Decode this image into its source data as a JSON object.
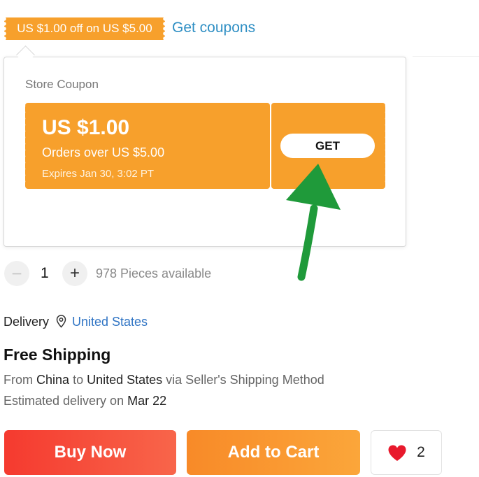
{
  "coupon_strip": {
    "tag_text": "US $1.00 off on US $5.00",
    "get_coupons_link": "Get coupons"
  },
  "popover": {
    "title": "Store Coupon",
    "coupon": {
      "amount": "US $1.00",
      "condition": "Orders over US $5.00",
      "expiry": "Expires Jan 30, 3:02 PT",
      "get_button": "GET"
    }
  },
  "quantity": {
    "minus": "−",
    "value": "1",
    "plus": "+",
    "available": "978 Pieces available"
  },
  "delivery": {
    "label": "Delivery",
    "location_icon": "map-pin-icon",
    "country": "United States"
  },
  "shipping": {
    "title": "Free Shipping",
    "from_word": "From",
    "origin": "China",
    "to_word": "to",
    "destination": "United States",
    "via_text": "via Seller's Shipping Method",
    "eta_prefix": "Estimated delivery on",
    "eta_date": "Mar 22"
  },
  "actions": {
    "buy_now": "Buy Now",
    "add_to_cart": "Add to Cart",
    "wishlist_count": "2"
  },
  "colors": {
    "coupon_orange": "#f7a02c",
    "link_blue": "#2f8fc4",
    "buy_now_red": "#f53a2f",
    "add_to_cart_orange": "#f88a28",
    "annotation_green": "#1f9a3a",
    "heart_red": "#e8192c"
  }
}
